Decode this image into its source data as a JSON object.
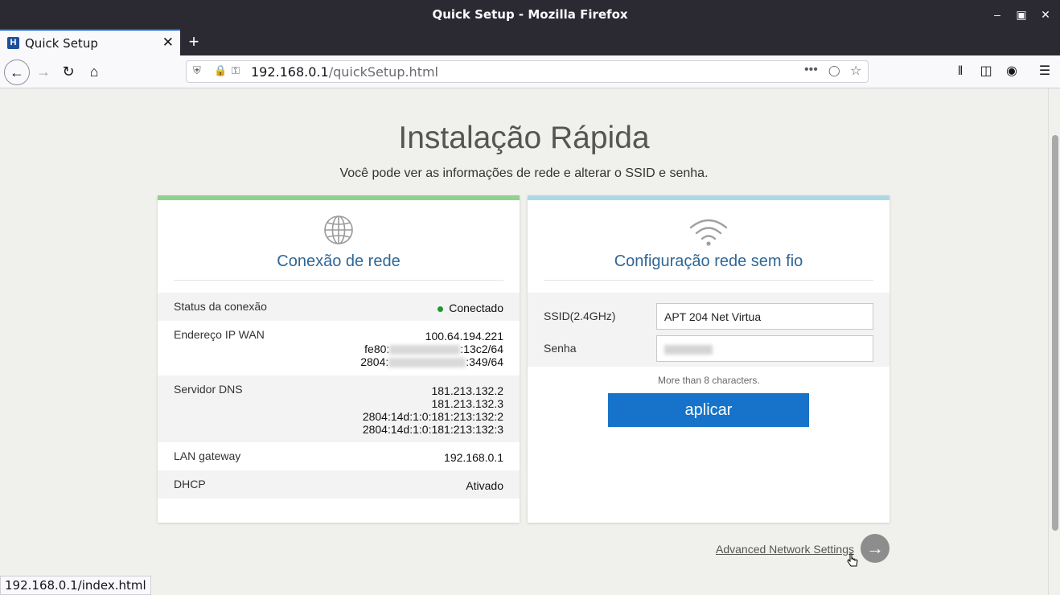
{
  "window": {
    "title": "Quick Setup - Mozilla Firefox"
  },
  "tab": {
    "label": "Quick Setup",
    "favicon_letter": "H"
  },
  "navbar": {
    "url_host": "192.168.0.1",
    "url_path": "/quickSetup.html"
  },
  "page": {
    "title": "Instalação Rápida",
    "subtitle": "Você pode ver as informações de rede e alterar o SSID e senha."
  },
  "network_card": {
    "title": "Conexão de rede",
    "status_label": "Status da conexão",
    "status_value": "Conectado",
    "wan_label": "Endereço IP WAN",
    "wan_ipv4": "100.64.194.221",
    "wan_ipv6_1_prefix": "fe80:",
    "wan_ipv6_1_suffix": ":13c2/64",
    "wan_ipv6_2_prefix": "2804:",
    "wan_ipv6_2_suffix": ":349/64",
    "dns_label": "Servidor DNS",
    "dns_values": [
      "181.213.132.2",
      "181.213.132.3",
      "2804:14d:1:0:181:213:132:2",
      "2804:14d:1:0:181:213:132:3"
    ],
    "lan_label": "LAN gateway",
    "lan_value": "192.168.0.1",
    "dhcp_label": "DHCP",
    "dhcp_value": "Ativado"
  },
  "wireless_card": {
    "title": "Configuração rede sem fio",
    "ssid_label": "SSID(2.4GHz)",
    "ssid_value": "APT 204 Net Virtua",
    "password_label": "Senha",
    "hint": "More than 8 characters.",
    "apply_label": "aplicar"
  },
  "advanced_link": "Advanced Network Settings",
  "status_bar": "192.168.0.1/index.html",
  "colors": {
    "accent_blue": "#1673c9",
    "title_blue": "#2f6797",
    "connected_green": "#1a8a2e",
    "left_card_border": "#8fd18f",
    "right_card_border": "#add8e6"
  }
}
